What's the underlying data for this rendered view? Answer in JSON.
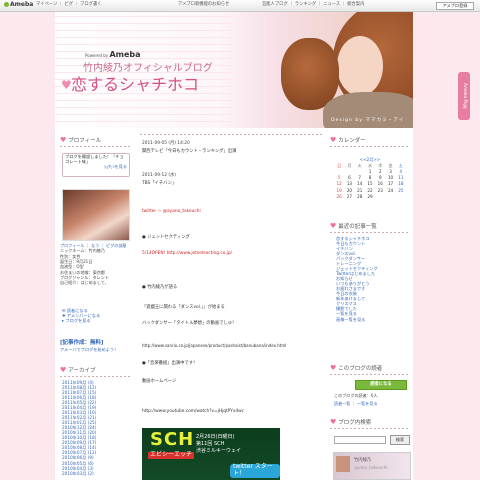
{
  "topbar": {
    "logo": "Ameba",
    "nav": "マイページ ｜ ピグ ｜ ブログ書く",
    "notice": "アメブロ新機能のお知らせ",
    "right": "芸能人ブログ ｜ ランキング ｜ ニュース ｜ 総合案内",
    "button": "アメブロ登録"
  },
  "header": {
    "powered_by": "Powered by",
    "ameba": "Ameba",
    "subtitle": "竹内綾乃オフィシャルブログ",
    "title": "恋するシャチホコ",
    "design_credit": "Design by ママカミ・アイ"
  },
  "side_tab": "Ameba Pigg",
  "profile": {
    "heading": "プロフィール",
    "message": "ブログを開設しました！「チョコレート味」",
    "message_more": "ｼｮｳﾋﾝを見る",
    "links": "プロフィール ｜ なう ｜ ピグの部屋",
    "info": [
      "ニックネーム：竹内綾乃",
      "性別：女性",
      "誕生日：9月21日",
      "血液型：O型",
      "お住まいの地域：東京都",
      "ブログジャンル：タレント",
      "自己紹介：はじめまして、"
    ],
    "reader_links": [
      "読者になる",
      "アメンバーになる",
      "ブログを見る"
    ]
  },
  "record": {
    "title": "[記事作成：無料]",
    "subtitle": "アメーバでブログを始めよう！"
  },
  "archive": {
    "heading": "アーカイブ",
    "items": [
      "2011年09月 (4)",
      "2011年08月 (12)",
      "2011年07月 (15)",
      "2011年06月 (18)",
      "2011年05月 (22)",
      "2011年04月 (19)",
      "2011年03月 (16)",
      "2011年02月 (21)",
      "2011年01月 (25)",
      "2010年12月 (24)",
      "2010年11月 (20)",
      "2010年10月 (18)",
      "2010年09月 (17)",
      "2010年08月 (14)",
      "2010年07月 (12)",
      "2010年06月 (9)",
      "2010年05月 (6)",
      "2010年04月 (3)",
      "2010年03月 (2)",
      "2010年02月 (1)"
    ]
  },
  "post1": {
    "date": "2011-09-05 (月) 14:20",
    "title": "関西テレビ「今日もカウント・ランキング」出演"
  },
  "post2": {
    "date": "2011-09-12 (水)",
    "title": "TBS「イチバン」",
    "lines": [
      "twitter ☆ @ayano_takeuchi",
      "● ジェットセクティング",
      "5/14OPEN! http://www.jetsetsecting.co.jp/",
      "● 竹内綾乃が語る",
      "「遊戯王に関わる「ダンスvol.」」が始まる",
      "バックダンサー「タイトル夢想」の動画でしゅ！",
      "http://www.sanrio.co.jp/japanese/product/pashaist/banubana/index.html",
      "●「音楽番組」出演中です！",
      "動画ホームページ",
      "http://www.youtube.com/watch?v=jHjqtPYx4wc"
    ]
  },
  "banner": {
    "logo": "SCH",
    "sub": "エビシーエッチ",
    "date": "2月26日(日曜日)",
    "place": "第11回 SCH",
    "venue": "渋谷ミルキーウェイ",
    "tw": "twitter",
    "start": "スタート！"
  },
  "calendar": {
    "heading": "カレンダー",
    "nav": "<<2月>>",
    "weekdays": [
      "日",
      "月",
      "火",
      "水",
      "木",
      "金",
      "土"
    ],
    "days": [
      "",
      "",
      "",
      "1",
      "2",
      "3",
      "4",
      "5",
      "6",
      "7",
      "8",
      "9",
      "10",
      "11",
      "12",
      "13",
      "14",
      "15",
      "16",
      "17",
      "18",
      "19",
      "20",
      "21",
      "22",
      "23",
      "24",
      "25",
      "26",
      "27",
      "28",
      "29",
      "",
      ""
    ]
  },
  "recent": {
    "heading": "最近の記事一覧",
    "items": [
      "恋するシャチホコ",
      "今日もカウント",
      "イチバン",
      "ダンスvol.",
      "バックダンサー",
      "トレーニング",
      "ジェットセクティング",
      "Twitterはじめました",
      "お知らせ",
      "いつもありがとう",
      "お疲れさまです",
      "今日の衣装",
      "新年あけまして",
      "クリスマス",
      "撮影でした"
    ],
    "more_links": [
      "一覧を見る",
      "画像一覧を見る"
    ]
  },
  "readers": {
    "heading": "このブログの読者",
    "button": "読者になる",
    "count": "このブログの読者：0人",
    "links": "読者一覧 ｜ 一覧を見る"
  },
  "search": {
    "heading": "ブログ内検索",
    "button": "検索"
  },
  "rbanner": {
    "name": "竹内綾乃",
    "sub": "ayano_takeuchi"
  },
  "colors": {
    "accent_pink": "#e77ea2",
    "link_blue": "#3366bb",
    "green_button": "#7bb93a"
  }
}
